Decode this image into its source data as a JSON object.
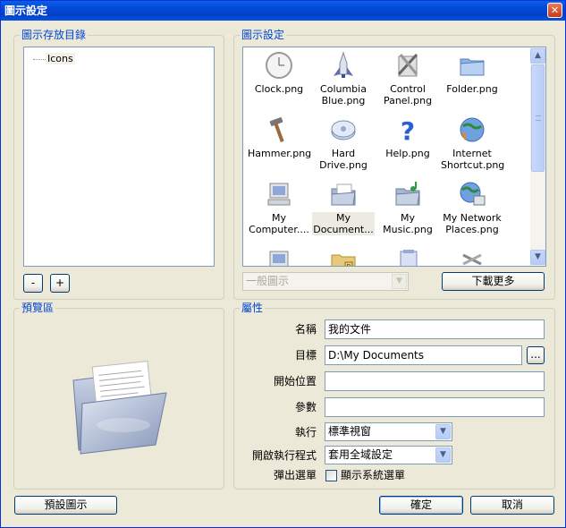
{
  "window": {
    "title": "圖示設定",
    "close_label": "✕"
  },
  "folders_group": {
    "label": "圖示存放目錄",
    "tree_item": "Icons",
    "remove_label": "-",
    "add_label": "+"
  },
  "icons_group": {
    "label": "圖示設定",
    "icons": [
      {
        "label": "Clock.png",
        "icon": "clock-icon"
      },
      {
        "label": "Columbia Blue.png",
        "icon": "shuttle-icon"
      },
      {
        "label": "Control Panel.png",
        "icon": "control-panel-icon"
      },
      {
        "label": "Folder.png",
        "icon": "folder-icon"
      },
      {
        "label": "Hammer.png",
        "icon": "hammer-icon"
      },
      {
        "label": "Hard Drive.png",
        "icon": "hard-drive-icon"
      },
      {
        "label": "Help.png",
        "icon": "help-icon"
      },
      {
        "label": "Internet Shortcut.png",
        "icon": "internet-icon"
      },
      {
        "label": "My Computer....",
        "icon": "computer-icon"
      },
      {
        "label": "My Document...",
        "icon": "my-documents-icon"
      },
      {
        "label": "My Music.png",
        "icon": "music-folder-icon"
      },
      {
        "label": "My Network Places.png",
        "icon": "network-icon"
      },
      {
        "label": "",
        "icon": "computer-partial-icon"
      },
      {
        "label": "",
        "icon": "folder-r-partial-icon"
      },
      {
        "label": "",
        "icon": "note-partial-icon"
      },
      {
        "label": "",
        "icon": "tools-partial-icon"
      }
    ],
    "category_value": "一般圖示",
    "download_more_label": "下載更多"
  },
  "preview_group": {
    "label": "預覽區"
  },
  "properties_group": {
    "label": "屬性",
    "name_label": "名稱",
    "name_value": "我的文件",
    "target_label": "目標",
    "target_value": "D:\\My Documents",
    "browse_label": "...",
    "start_in_label": "開始位置",
    "start_in_value": "",
    "params_label": "參數",
    "params_value": "",
    "run_label": "執行",
    "run_value": "標準視窗",
    "open_with_label": "開啟執行程式",
    "open_with_value": "套用全域設定",
    "popup_label": "彈出選單",
    "show_system_menu_label": "顯示系統選單"
  },
  "footer": {
    "default_icon_label": "預設圖示",
    "ok_label": "確定",
    "cancel_label": "取消"
  }
}
